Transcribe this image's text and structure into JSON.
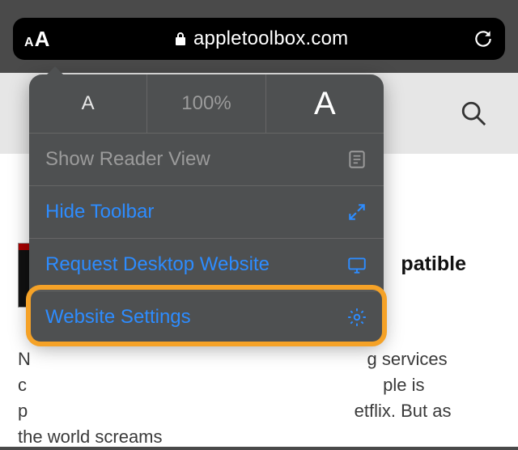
{
  "url_bar": {
    "domain": "appletoolbox.com"
  },
  "popover": {
    "zoom_percent": "100%",
    "reader_label": "Show Reader View",
    "hide_toolbar_label": "Hide Toolbar",
    "request_desktop_label": "Request Desktop Website",
    "website_settings_label": "Website Settings"
  },
  "article": {
    "title_fragment": "patible",
    "body_line1_right": "g services",
    "body_line2_right": "ple is",
    "body_line3_right": "etflix. But as",
    "body_line4": "the world screams"
  }
}
